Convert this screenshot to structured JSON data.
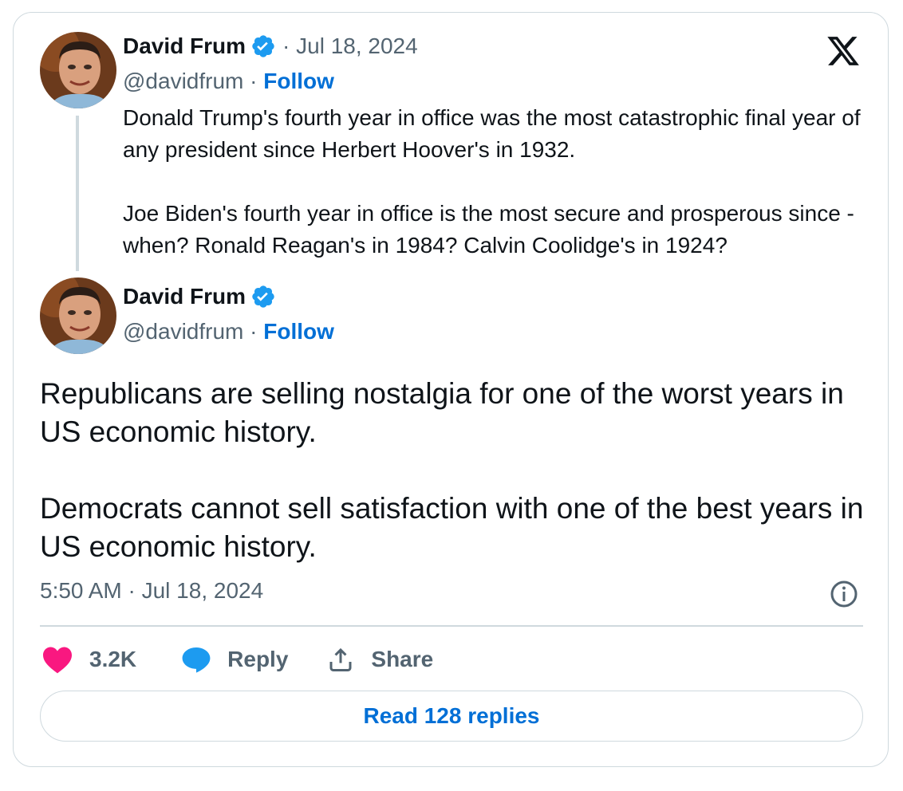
{
  "quoted_tweet": {
    "author_name": "David Frum",
    "date": "· Jul 18, 2024",
    "handle": "@davidfrum",
    "separator": "·",
    "follow_label": "Follow",
    "text": "Donald Trump's fourth year in office was the most catastrophic final year of any president since Herbert Hoover's in 1932.\n\nJoe Biden's fourth year in office is the most secure and prosperous since - when? Ronald Reagan's in 1984? Calvin Coolidge's in 1924?"
  },
  "main_tweet": {
    "author_name": "David Frum",
    "handle": "@davidfrum",
    "separator": "·",
    "follow_label": "Follow",
    "text": "Republicans are selling nostalgia for one of the worst years in US economic history.\n\nDemocrats cannot sell satisfaction with one of the best years in US economic history.",
    "timestamp": "5:50 AM · Jul 18, 2024"
  },
  "actions": {
    "like_count": "3.2K",
    "reply_label": "Reply",
    "share_label": "Share"
  },
  "read_replies_label": "Read 128 replies",
  "colors": {
    "verified": "#1d9bf0",
    "follow": "#006fd6",
    "like": "#f91880",
    "reply": "#1d9bf0",
    "secondary_text": "#536471",
    "border": "#cfd9de"
  },
  "icons": [
    "x-logo-icon",
    "verified-badge-icon",
    "info-icon",
    "heart-icon",
    "reply-bubble-icon",
    "share-icon"
  ]
}
